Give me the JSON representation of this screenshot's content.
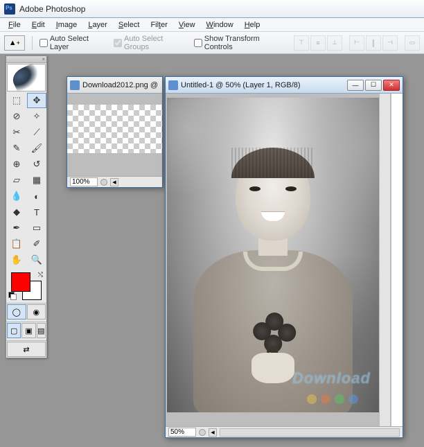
{
  "titlebar": {
    "app_name": "Adobe Photoshop"
  },
  "menu": {
    "file": "File",
    "edit": "Edit",
    "image": "Image",
    "layer": "Layer",
    "select": "Select",
    "filter": "Filter",
    "view": "View",
    "window": "Window",
    "help": "Help"
  },
  "options": {
    "auto_select_layer": "Auto Select Layer",
    "auto_select_groups": "Auto Select Groups",
    "show_transform_controls": "Show Transform Controls"
  },
  "colors": {
    "foreground": "#ff0000",
    "background": "#ffffff"
  },
  "doc1": {
    "title": "Download2012.png @",
    "zoom": "100%"
  },
  "doc2": {
    "title": "Untitled-1 @ 50% (Layer 1, RGB/8)",
    "zoom": "50%"
  },
  "watermark": "Download"
}
